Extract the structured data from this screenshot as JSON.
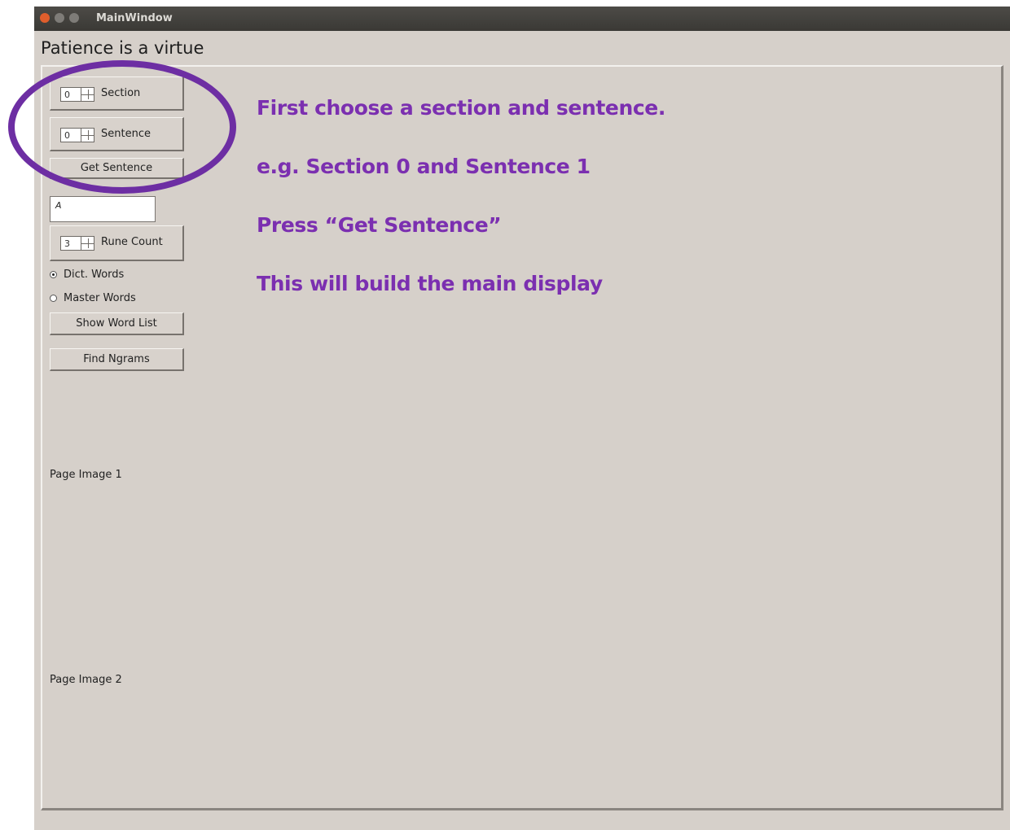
{
  "window": {
    "title": "MainWindow"
  },
  "app": {
    "heading": "Patience is a virtue"
  },
  "controls": {
    "section": {
      "value": "0",
      "label": "Section"
    },
    "sentence": {
      "value": "0",
      "label": "Sentence"
    },
    "get_sentence_label": "Get Sentence",
    "text_input_value": "A",
    "rune_count": {
      "value": "3",
      "label": "Rune Count"
    },
    "radio_dict_label": "Dict. Words",
    "radio_master_label": "Master Words",
    "radio_selected": "Dict. Words",
    "show_word_list_label": "Show Word List",
    "find_ngrams_label": "Find Ngrams"
  },
  "page_images": {
    "label_1": "Page Image 1",
    "label_2": "Page Image 2"
  },
  "annotations": {
    "line1": "First choose a section and sentence.",
    "line2": "e.g. Section 0 and Sentence 1",
    "line3": "Press “Get Sentence”",
    "line4": "This will build the main display",
    "color": "#7b2fb0",
    "ring_color": "#6d2ea3"
  }
}
